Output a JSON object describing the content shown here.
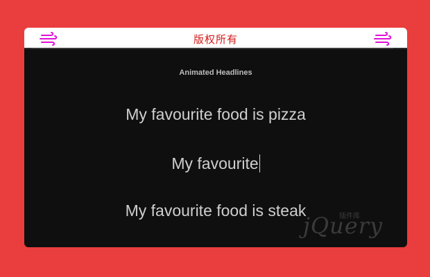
{
  "header": {
    "title": "版权所有",
    "left_icon": "wind-icon",
    "right_icon": "wind-icon",
    "title_color": "#d61b1b",
    "icon_color": "#e00fd8"
  },
  "main": {
    "subtitle": "Animated Headlines",
    "headlines": [
      "My favourite food is pizza",
      "My favourite",
      "My favourite food is steak"
    ]
  },
  "watermark": {
    "text": "jQuery",
    "subtext": "插件库"
  },
  "colors": {
    "page_background": "#ea3d3d",
    "card_background": "#0f0f0f",
    "headline_text": "#cfcfcf"
  }
}
